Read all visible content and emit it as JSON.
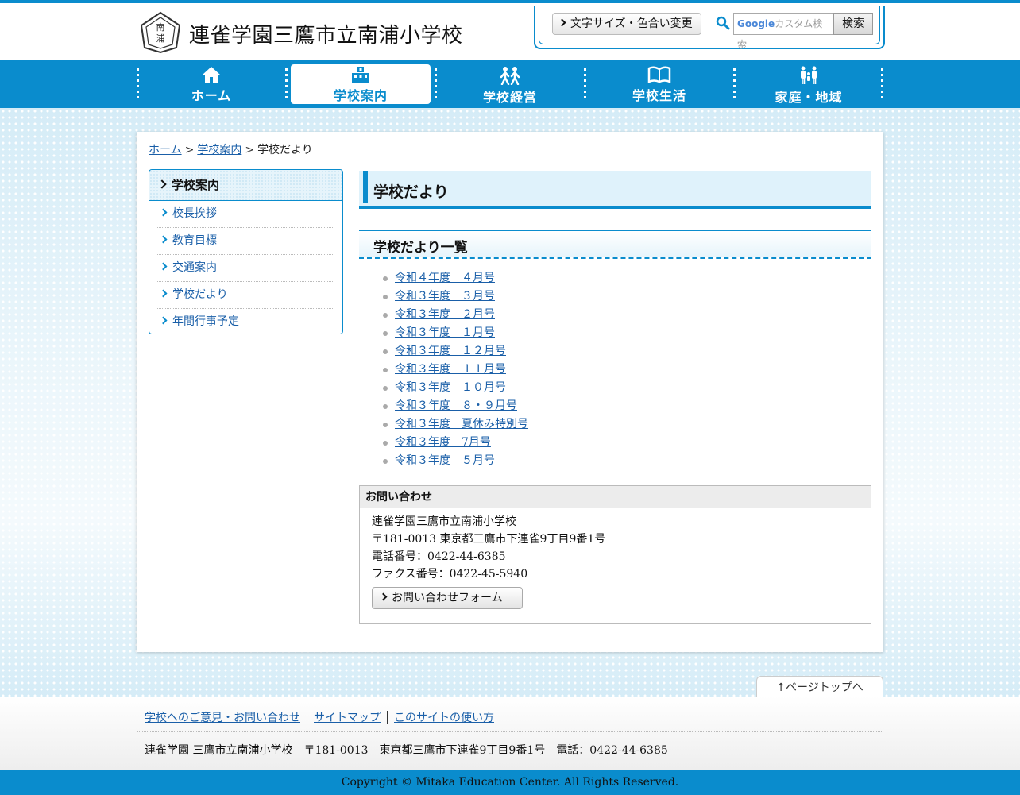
{
  "header": {
    "site_title": "連雀学園三鷹市立南浦小学校",
    "logo_text": "南浦",
    "font_color_button": "文字サイズ・色合い変更",
    "search_brand": "Google",
    "search_placeholder": "カスタム検索",
    "search_button": "検索"
  },
  "nav": {
    "items": [
      {
        "label": "ホーム",
        "icon": "home-icon"
      },
      {
        "label": "学校案内",
        "icon": "school-building-icon",
        "active": true
      },
      {
        "label": "学校経営",
        "icon": "people-icon"
      },
      {
        "label": "学校生活",
        "icon": "book-icon"
      },
      {
        "label": "家庭・地域",
        "icon": "family-icon"
      }
    ]
  },
  "breadcrumb": {
    "home": "ホーム",
    "sep": ">",
    "parent": "学校案内",
    "current": "学校だより"
  },
  "sidebar": {
    "heading": "学校案内",
    "items": [
      "校長挨拶",
      "教育目標",
      "交通案内",
      "学校だより",
      "年間行事予定"
    ]
  },
  "main": {
    "page_title": "学校だより",
    "section_title": "学校だより一覧",
    "newsletters": [
      "令和４年度　４月号",
      "令和３年度　３月号",
      "令和３年度　２月号",
      "令和３年度　１月号",
      "令和３年度　１２月号",
      "令和３年度　１１月号",
      "令和３年度　１０月号",
      "令和３年度　８・９月号",
      "令和３年度　夏休み特別号",
      "令和３年度　7月号",
      "令和３年度　５月号"
    ]
  },
  "contact": {
    "heading": "お問い合わせ",
    "name": "連雀学園三鷹市立南浦小学校",
    "address": "〒181-0013 東京都三鷹市下連雀9丁目9番1号",
    "phone": "電話番号：0422-44-6385",
    "fax": "ファクス番号：0422-45-5940",
    "form_button": "お問い合わせフォーム"
  },
  "page_top": "↑ページトップへ",
  "footer": {
    "links": [
      "学校へのご意見・お問い合わせ",
      "サイトマップ",
      "このサイトの使い方"
    ],
    "address": "連雀学園 三鷹市立南浦小学校　〒181-0013　東京都三鷹市下連雀9丁目9番1号　電話：0422-44-6385",
    "copyright": "Copyright © Mitaka Education Center. All Rights Reserved."
  },
  "colors": {
    "accent": "#0a8ccd",
    "link": "#1a5fa8",
    "background_pattern": "#d5ecf7"
  }
}
